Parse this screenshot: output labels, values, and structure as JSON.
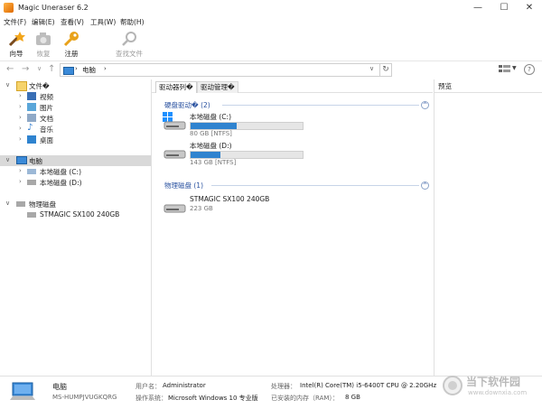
{
  "window": {
    "title": "Magic Uneraser 6.2"
  },
  "window_buttons": {
    "minimize": "—",
    "maximize": "☐",
    "close": "✕"
  },
  "menu": [
    "文件(F)",
    "编辑(E)",
    "查看(V)",
    "工具(W)",
    "帮助(H)"
  ],
  "toolbar": {
    "wizard": "向导",
    "restore": "恢复",
    "register": "注册",
    "find": "查找文件"
  },
  "address": {
    "path_item": "电脑",
    "separator": "›"
  },
  "tree": {
    "files_root": "文件�",
    "videos": "视频",
    "pictures": "图片",
    "documents": "文档",
    "music": "音乐",
    "desktop": "桌面",
    "computer": "电脑",
    "local_c": "本地磁盘 (C:)",
    "local_d": "本地磁盘 (D:)",
    "physical_disks": "物理磁盘",
    "stmagic": "STMAGIC SX100 240GB"
  },
  "tabs": {
    "driver_list": "驱动器列�",
    "driver_manage": "驱动管理�"
  },
  "groups": {
    "hard_drives": "硬盘驱动� (2)",
    "physical": "物理磁盘 (1)",
    "collapse": "^"
  },
  "drives": [
    {
      "name": "本地磁盘 (C:)",
      "info": "80 GB [NTFS]",
      "used": 0.41
    },
    {
      "name": "本地磁盘 (D:)",
      "info": "143 GB [NTFS]",
      "used": 0.27
    }
  ],
  "physical_disk": {
    "name": "STMAGIC SX100 240GB",
    "info": "223 GB"
  },
  "preview": {
    "title": "预览"
  },
  "status": {
    "computer": "电脑",
    "machine": "MS-HUMPJVUGKQRG",
    "user_label": "用户名：",
    "user_value": "Administrator",
    "os_label": "操作系统：",
    "os_value": "Microsoft Windows 10 专业版",
    "cpu_label": "处理器：",
    "cpu_value": "Intel(R) Core(TM) i5-6400T CPU @ 2.20GHz",
    "ram_label": "已安装的内存（RAM）：",
    "ram_value": "8 GB"
  },
  "watermark": {
    "text1": "当下软件园",
    "text2": "www.downxia.com"
  },
  "colors": {
    "accent": "#2f83cf",
    "group": "#2a52a0",
    "selected": "#d9d9d9"
  }
}
